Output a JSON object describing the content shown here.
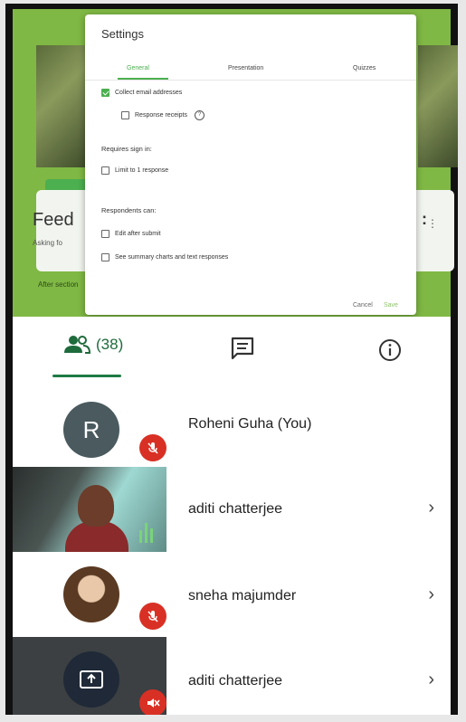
{
  "background_form": {
    "title_fragment": "Feed",
    "subtitle_fragment": "Asking fo",
    "after_section": "After section"
  },
  "settings": {
    "title": "Settings",
    "tabs": [
      {
        "label": "General",
        "active": true
      },
      {
        "label": "Presentation",
        "active": false
      },
      {
        "label": "Quizzes",
        "active": false
      }
    ],
    "collect_email": {
      "label": "Collect email addresses",
      "checked": true
    },
    "response_receipts": {
      "label": "Response receipts",
      "checked": false
    },
    "requires_sign_in": "Requires sign in:",
    "limit_response": {
      "label": "Limit to 1 response",
      "checked": false
    },
    "respondents_can": "Respondents can:",
    "edit_after_submit": {
      "label": "Edit after submit",
      "checked": false
    },
    "see_summary": {
      "label": "See summary charts and text responses",
      "checked": false
    },
    "cancel_label": "Cancel",
    "save_label": "Save"
  },
  "participants": {
    "count_label": "(38)",
    "list": [
      {
        "name": "Roheni Guha (You)",
        "initial": "R",
        "muted": true
      },
      {
        "name": "aditi chatterjee",
        "muted": false
      },
      {
        "name": "sneha majumder",
        "muted": true
      },
      {
        "name": "aditi chatterjee",
        "muted": true
      }
    ]
  },
  "colors": {
    "accent_green": "#1e7a44",
    "forms_green": "#4caf50",
    "mute_red": "#d93025"
  }
}
